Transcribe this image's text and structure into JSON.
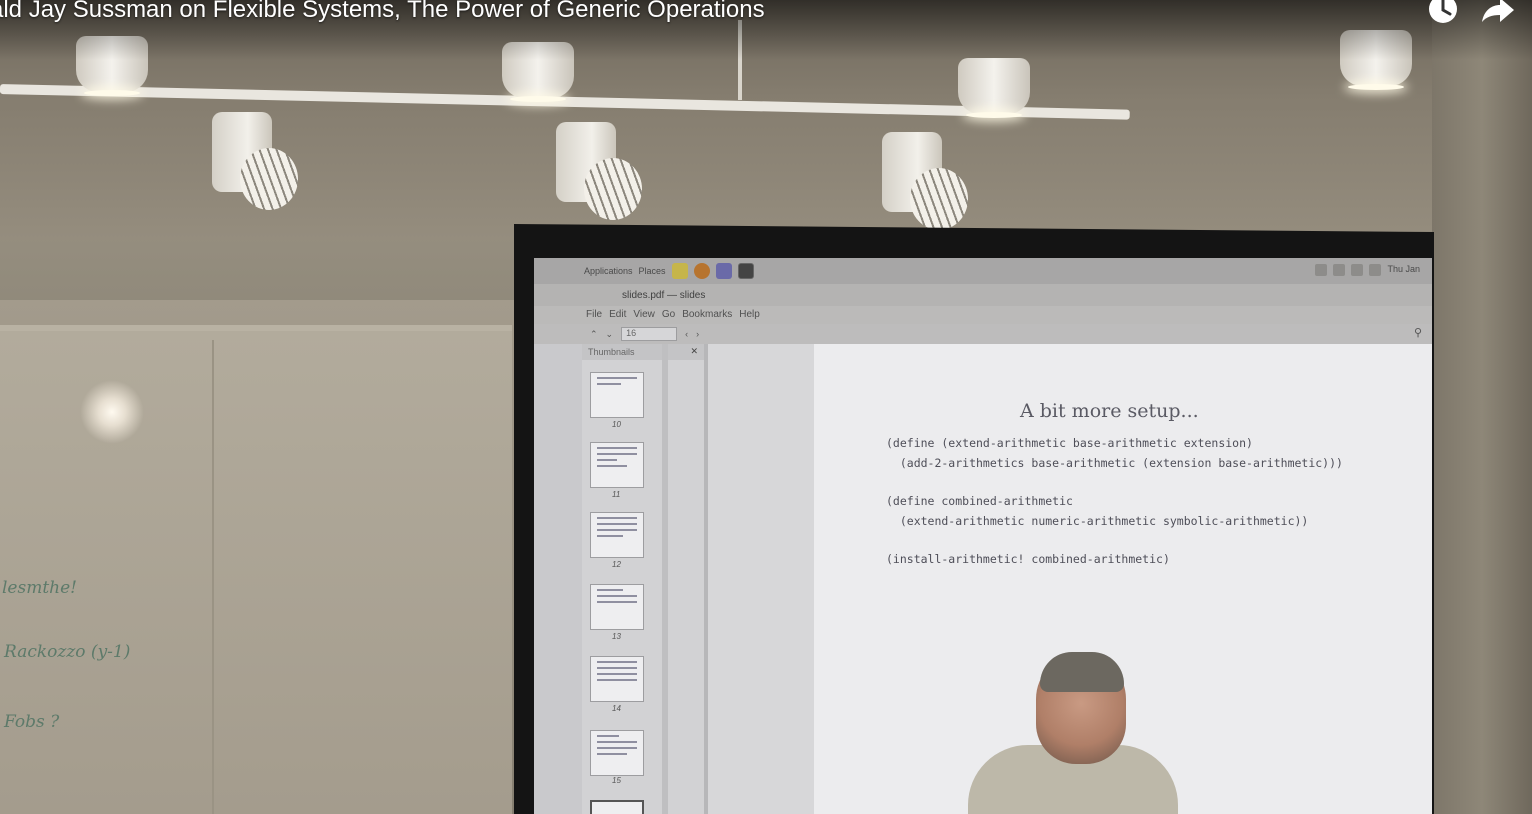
{
  "video": {
    "title": "ald Jay Sussman on Flexible Systems, The Power of Generic Operations"
  },
  "controls": {
    "watch_later_icon": "clock-icon",
    "share_icon": "share-arrow-icon"
  },
  "desktop": {
    "topbar": {
      "applications": "Applications",
      "places": "Places",
      "clock": "Thu Jan"
    },
    "window_title": "slides.pdf — slides",
    "menu": [
      "File",
      "Edit",
      "View",
      "Go",
      "Bookmarks",
      "Help"
    ],
    "page_entry": "16"
  },
  "sidebar": {
    "header": "Thumbnails",
    "thumb_numbers": [
      "10",
      "11",
      "12",
      "13",
      "14",
      "15"
    ]
  },
  "slide": {
    "title": "A bit more setup...",
    "code_lines": [
      "(define (extend-arithmetic base-arithmetic extension)",
      "  (add-2-arithmetics base-arithmetic (extension base-arithmetic)))",
      "(define combined-arithmetic",
      "  (extend-arithmetic numeric-arithmetic symbolic-arithmetic))",
      "(install-arithmetic! combined-arithmetic)"
    ]
  },
  "whiteboard": {
    "notes": [
      "lesmthe!",
      "Rackozzo (y-1)",
      "Fobs ?"
    ]
  }
}
